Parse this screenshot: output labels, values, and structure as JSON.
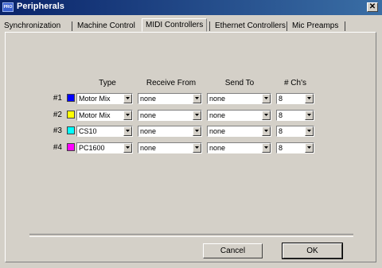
{
  "window": {
    "title": "Peripherals",
    "app_badge": "PRO"
  },
  "tabs": [
    {
      "label": "Synchronization"
    },
    {
      "label": "Machine Control"
    },
    {
      "label": "MIDI Controllers"
    },
    {
      "label": "Ethernet Controllers"
    },
    {
      "label": "Mic Preamps"
    }
  ],
  "active_tab": "MIDI Controllers",
  "table": {
    "headers": {
      "type": "Type",
      "receive": "Receive From",
      "send": "Send To",
      "channels": "# Ch's"
    },
    "rows": [
      {
        "num": "#1",
        "color": "#0000ff",
        "type": "Motor Mix",
        "receive": "none",
        "send": "none",
        "channels": "8"
      },
      {
        "num": "#2",
        "color": "#ffff00",
        "type": "Motor Mix",
        "receive": "none",
        "send": "none",
        "channels": "8"
      },
      {
        "num": "#3",
        "color": "#00ffff",
        "type": "CS10",
        "receive": "none",
        "send": "none",
        "channels": "8"
      },
      {
        "num": "#4",
        "color": "#ff00ff",
        "type": "PC1600",
        "receive": "none",
        "send": "none",
        "channels": "8"
      }
    ]
  },
  "buttons": {
    "cancel": "Cancel",
    "ok": "OK"
  }
}
